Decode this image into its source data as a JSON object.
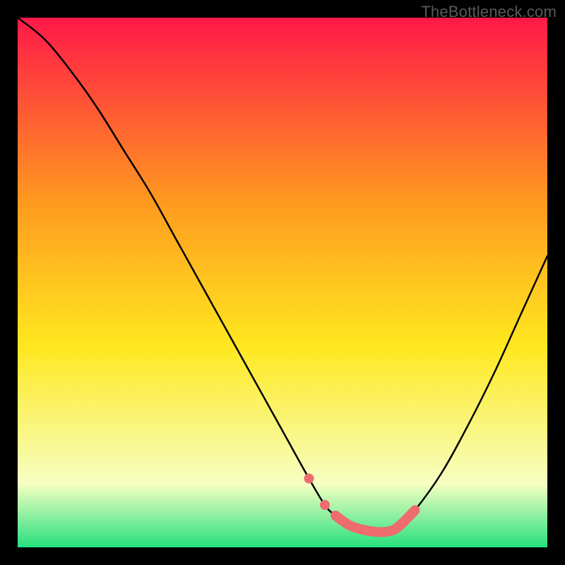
{
  "watermark": "TheBottleneck.com",
  "chart_data": {
    "type": "line",
    "title": "",
    "xlabel": "",
    "ylabel": "",
    "xlim": [
      0,
      100
    ],
    "ylim": [
      0,
      100
    ],
    "series": [
      {
        "name": "bottleneck-curve",
        "x": [
          0,
          5,
          10,
          15,
          20,
          25,
          30,
          35,
          40,
          45,
          50,
          55,
          58,
          60,
          63,
          67,
          70,
          72,
          75,
          80,
          85,
          90,
          95,
          100
        ],
        "values": [
          100,
          96,
          90,
          83,
          75,
          67,
          58,
          49,
          40,
          31,
          22,
          13,
          8,
          6,
          4,
          3,
          3,
          4,
          7,
          14,
          23,
          33,
          44,
          55
        ]
      }
    ],
    "highlight": {
      "name": "optimal-region",
      "color": "#ee6b6e",
      "x": [
        55,
        58,
        60,
        63,
        67,
        70,
        72,
        75
      ],
      "values": [
        13,
        8,
        6,
        4,
        3,
        3,
        4,
        7
      ]
    },
    "background_gradient": {
      "top": "#ff1849",
      "mid1": "#ff9a1f",
      "mid2": "#ffe81f",
      "low": "#f6ffc2",
      "bottom": "#26e07f"
    }
  }
}
